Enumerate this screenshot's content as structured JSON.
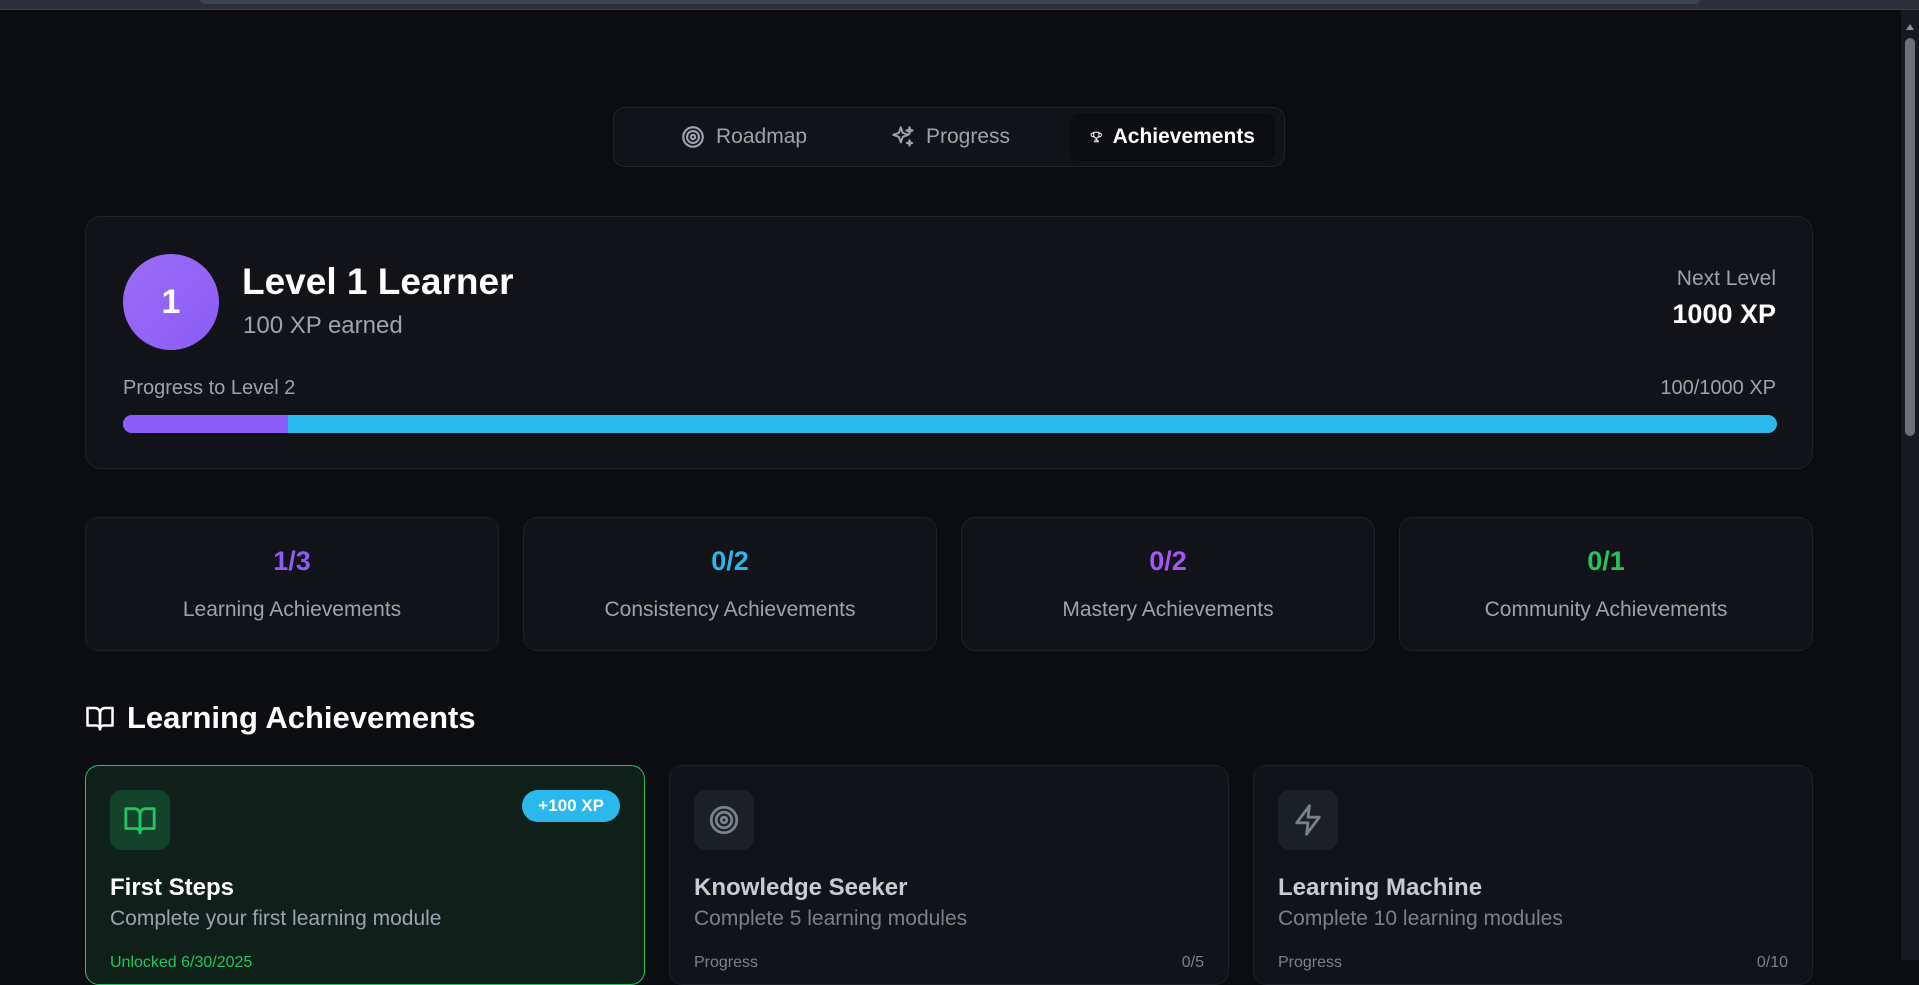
{
  "colors": {
    "background": "#0b0d11",
    "card": "#111318",
    "purple": "#8b5cf6",
    "cyan": "#2bb8ec",
    "green": "#22c55e",
    "muted": "#9ca3af"
  },
  "tabs": [
    {
      "label": "Roadmap",
      "icon": "target-icon",
      "active": false
    },
    {
      "label": "Progress",
      "icon": "sparkles-icon",
      "active": false
    },
    {
      "label": "Achievements",
      "icon": "trophy-icon",
      "active": true
    }
  ],
  "level": {
    "badge": "1",
    "title": "Level 1 Learner",
    "xp_earned": "100 XP earned",
    "next_label": "Next Level",
    "next_value": "1000 XP",
    "progress_label": "Progress to Level 2",
    "progress_value": "100/1000 XP",
    "progress_fraction": 0.1
  },
  "stats": [
    {
      "count": "1/3",
      "label": "Learning Achievements",
      "color": "#8b5cf6"
    },
    {
      "count": "0/2",
      "label": "Consistency Achievements",
      "color": "#2bb8ec"
    },
    {
      "count": "0/2",
      "label": "Mastery Achievements",
      "color": "#a855f7"
    },
    {
      "count": "0/1",
      "label": "Community Achievements",
      "color": "#22c55e"
    }
  ],
  "section": {
    "title": "Learning Achievements",
    "icon": "book-open-icon"
  },
  "achievements": [
    {
      "title": "First Steps",
      "description": "Complete your first learning module",
      "xp_badge": "+100 XP",
      "icon": "book-open-icon",
      "unlocked": true,
      "footer_left": "Unlocked 6/30/2025",
      "footer_right": ""
    },
    {
      "title": "Knowledge Seeker",
      "description": "Complete 5 learning modules",
      "xp_badge": "",
      "icon": "target-icon",
      "unlocked": false,
      "footer_left": "Progress",
      "footer_right": "0/5"
    },
    {
      "title": "Learning Machine",
      "description": "Complete 10 learning modules",
      "xp_badge": "",
      "icon": "zap-icon",
      "unlocked": false,
      "footer_left": "Progress",
      "footer_right": "0/10"
    }
  ]
}
